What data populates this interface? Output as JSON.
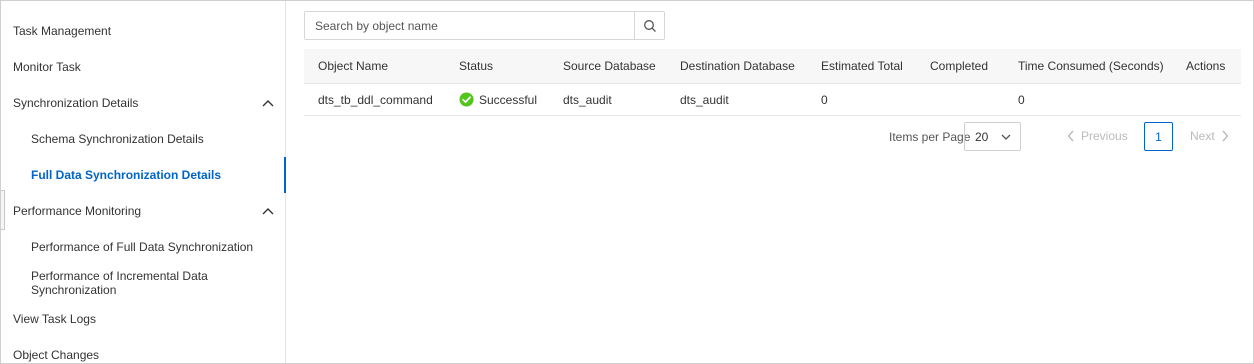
{
  "sidebar": {
    "items": [
      {
        "label": "Task Management"
      },
      {
        "label": "Monitor Task"
      },
      {
        "label": "Synchronization Details"
      },
      {
        "label": "Schema Synchronization Details"
      },
      {
        "label": "Full Data Synchronization Details"
      },
      {
        "label": "Performance Monitoring"
      },
      {
        "label": "Performance of Full Data Synchronization"
      },
      {
        "label": "Performance of Incremental Data Synchronization"
      },
      {
        "label": "View Task Logs"
      },
      {
        "label": "Object Changes"
      }
    ]
  },
  "search": {
    "placeholder": "Search by object name",
    "icon": "search-icon"
  },
  "table": {
    "columns": {
      "object_name": "Object Name",
      "status": "Status",
      "source_db": "Source Database",
      "dest_db": "Destination Database",
      "estimated_total": "Estimated Total",
      "completed": "Completed",
      "time_consumed": "Time Consumed (Seconds)",
      "actions": "Actions"
    },
    "rows": [
      {
        "object_name": "dts_tb_ddl_command",
        "status": "Successful",
        "source_db": "dts_audit",
        "dest_db": "dts_audit",
        "estimated_total": "0",
        "completed": "",
        "time_consumed": "0",
        "actions": ""
      }
    ]
  },
  "pagination": {
    "items_per_page_label": "Items per Page",
    "items_per_page_value": "20",
    "previous_label": "Previous",
    "current_page": "1",
    "next_label": "Next"
  },
  "colors": {
    "accent": "#0064c8",
    "success": "#52c41a",
    "disabled": "#bbbbbb"
  }
}
